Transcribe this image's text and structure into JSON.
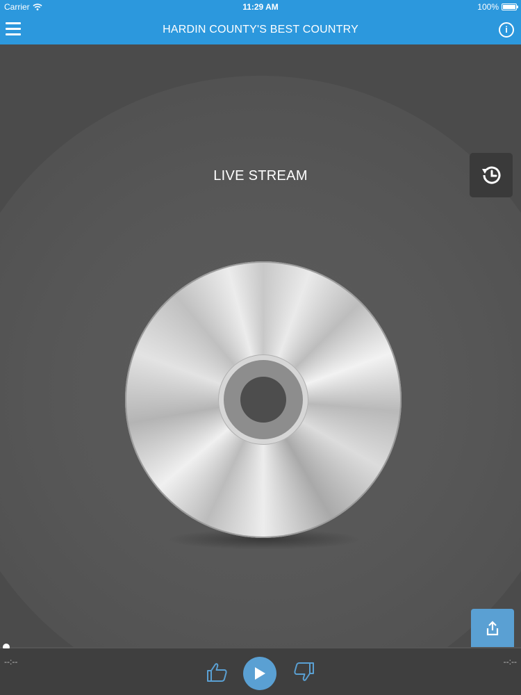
{
  "status_bar": {
    "carrier": "Carrier",
    "time": "11:29 AM",
    "battery": "100%",
    "battery_level": 1.0
  },
  "nav": {
    "title": "HARDIN COUNTY'S BEST COUNTRY",
    "menu_icon": "hamburger-menu-icon",
    "info_icon": "info-icon",
    "info_glyph": "i"
  },
  "main": {
    "stream_label": "LIVE STREAM",
    "history_icon": "history-icon",
    "share_icon": "share-icon",
    "artwork": "cd-disc"
  },
  "player": {
    "elapsed": "--:--",
    "remaining": "--:--",
    "progress": 0,
    "thumbs_up_icon": "thumbs-up-icon",
    "thumbs_down_icon": "thumbs-down-icon",
    "play_icon": "play-icon"
  },
  "colors": {
    "accent": "#2c98dd",
    "button": "#5aa0d3",
    "background": "#4b4b4b"
  }
}
